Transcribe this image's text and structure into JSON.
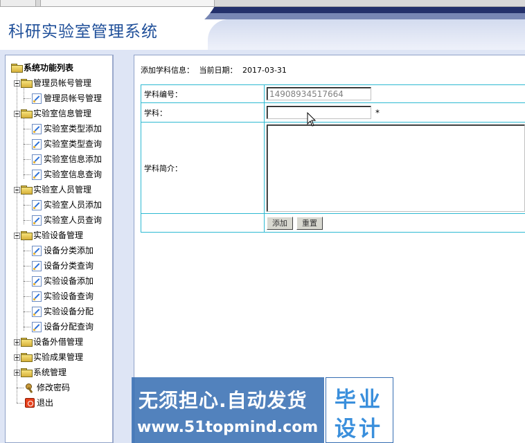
{
  "header": {
    "title": "科研实验室管理系统"
  },
  "sidebar": {
    "root_label": "系统功能列表",
    "groups": [
      {
        "label": "管理员帐号管理",
        "items": [
          "管理员帐号管理"
        ]
      },
      {
        "label": "实验室信息管理",
        "items": [
          "实验室类型添加",
          "实验室类型查询",
          "实验室信息添加",
          "实验室信息查询"
        ]
      },
      {
        "label": "实验室人员管理",
        "items": [
          "实验室人员添加",
          "实验室人员查询"
        ]
      },
      {
        "label": "实验设备管理",
        "items": [
          "设备分类添加",
          "设备分类查询",
          "实验设备添加",
          "实验设备查询",
          "实验设备分配",
          "设备分配查询"
        ]
      },
      {
        "label": "设备外借管理",
        "items": []
      },
      {
        "label": "实验成果管理",
        "items": []
      },
      {
        "label": "系统管理",
        "items": []
      }
    ],
    "change_password": "修改密码",
    "logout": "退出"
  },
  "form": {
    "header_label": "添加学科信息：",
    "date_label": "当前日期：",
    "date_value": "2017-03-31",
    "code_label": "学科编号：",
    "code_value": "14908934517664",
    "name_label": "学科：",
    "name_value": "",
    "required_mark": "*",
    "intro_label": "学科简介：",
    "intro_value": "",
    "add_button": "添加",
    "reset_button": "重置"
  },
  "watermark": {
    "line1": "无须担心.自动发货",
    "line2": "www.51topmind.com",
    "box_line1": "毕业",
    "box_line2": "设计"
  }
}
